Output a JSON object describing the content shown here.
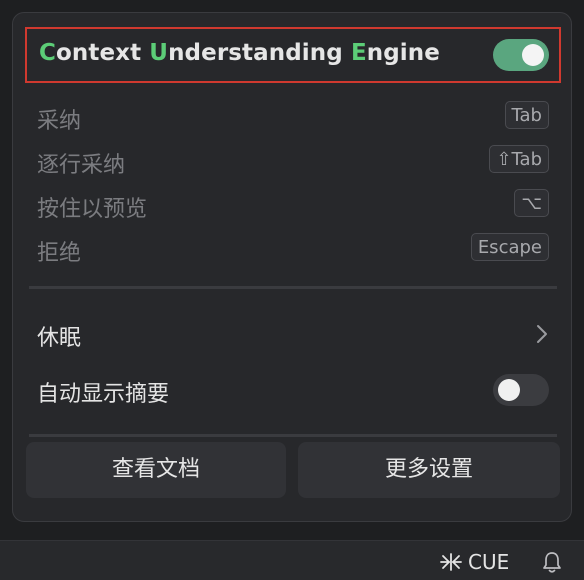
{
  "header": {
    "title_parts": [
      {
        "text": "C",
        "highlight": true
      },
      {
        "text": "ontext ",
        "highlight": false
      },
      {
        "text": "U",
        "highlight": true
      },
      {
        "text": "nderstanding ",
        "highlight": false
      },
      {
        "text": "E",
        "highlight": true
      },
      {
        "text": "ngine",
        "highlight": false
      }
    ],
    "enabled": true
  },
  "actions": [
    {
      "label": "采纳",
      "shortcut": "Tab"
    },
    {
      "label": "逐行采纳",
      "shortcut": "⇧Tab"
    },
    {
      "label": "按住以预览",
      "shortcut": "⌥"
    },
    {
      "label": "拒绝",
      "shortcut": "Escape"
    }
  ],
  "menu": {
    "sleep_label": "休眠",
    "auto_summary_label": "自动显示摘要",
    "auto_summary_enabled": false
  },
  "buttons": {
    "docs": "查看文档",
    "more_settings": "更多设置"
  },
  "statusbar": {
    "cue_label": "CUE"
  },
  "colors": {
    "accent_green": "#5ccd77",
    "toggle_on": "#5aa67f",
    "highlight_border": "#d0392f"
  },
  "icons": {
    "chevron": "chevron-right-icon",
    "cue": "cue-asterisk-icon",
    "bell": "bell-icon"
  }
}
